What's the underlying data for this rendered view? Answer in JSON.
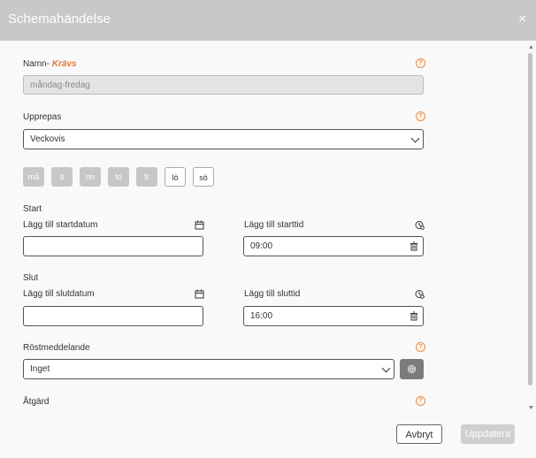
{
  "dialog": {
    "title": "Schemahändelse",
    "close": "×"
  },
  "name": {
    "label": "Namn-",
    "required": "Krävs",
    "value": "måndag-fredag"
  },
  "repeat": {
    "label": "Upprepas",
    "value": "Veckovis"
  },
  "days": [
    {
      "label": "må",
      "selected": true
    },
    {
      "label": "ti",
      "selected": true
    },
    {
      "label": "on",
      "selected": true
    },
    {
      "label": "to",
      "selected": true
    },
    {
      "label": "fr",
      "selected": true
    },
    {
      "label": "lö",
      "selected": false
    },
    {
      "label": "sö",
      "selected": false
    }
  ],
  "start": {
    "heading": "Start",
    "date_label": "Lägg till startdatum",
    "date_value": "",
    "time_label": "Lägg till starttid",
    "time_value": "09:00"
  },
  "end": {
    "heading": "Slut",
    "date_label": "Lägg till slutdatum",
    "date_value": "",
    "time_label": "Lägg till sluttid",
    "time_value": "16:00"
  },
  "voicemail": {
    "label": "Röstmeddelande",
    "value": "Inget"
  },
  "action": {
    "label": "Åtgärd"
  },
  "footer": {
    "cancel": "Avbryt",
    "update": "Uppdatera"
  },
  "colors": {
    "titlebar": "#c8c8c8",
    "required": "#e8772e",
    "help": "#f08a3a",
    "day_selected": "#c7c7c7",
    "update_disabled": "#cfcfcf"
  }
}
